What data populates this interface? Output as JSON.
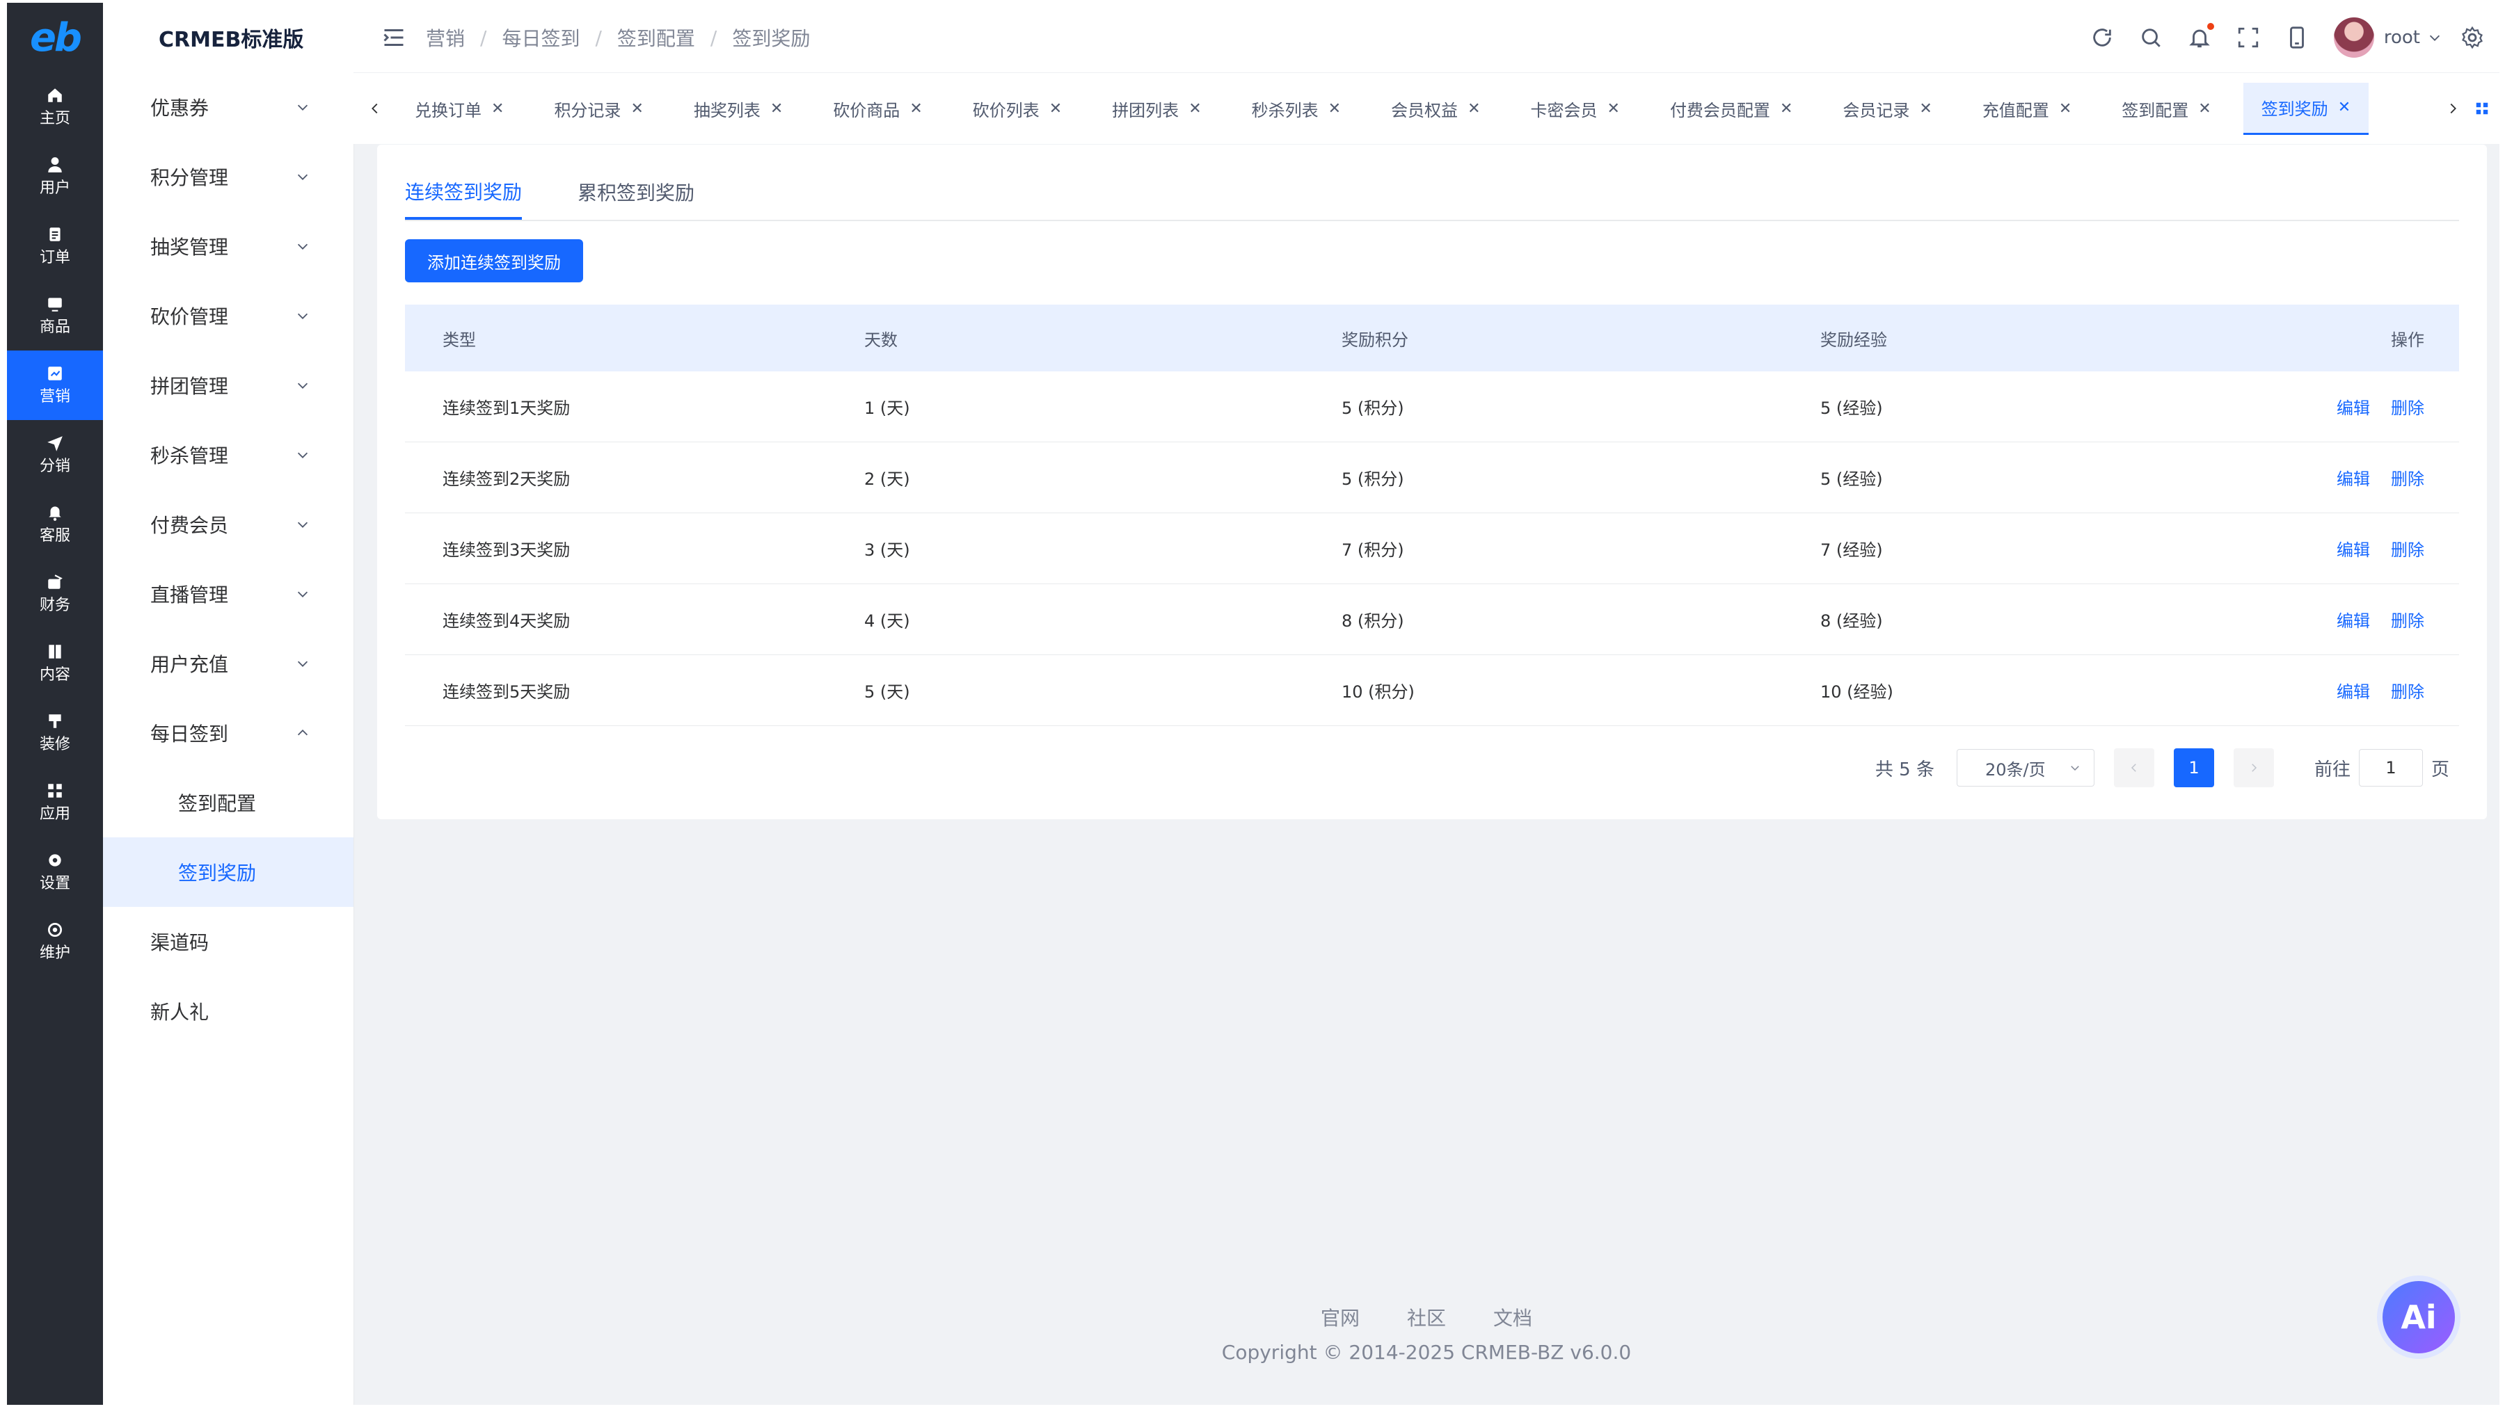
{
  "logo": "eb",
  "brand": "CRMEB标准版",
  "rail": [
    {
      "label": "主页",
      "icon": "home-icon"
    },
    {
      "label": "用户",
      "icon": "user-icon"
    },
    {
      "label": "订单",
      "icon": "order-icon"
    },
    {
      "label": "商品",
      "icon": "product-icon"
    },
    {
      "label": "营销",
      "icon": "marketing-icon",
      "active": true
    },
    {
      "label": "分销",
      "icon": "distribution-icon"
    },
    {
      "label": "客服",
      "icon": "service-icon"
    },
    {
      "label": "财务",
      "icon": "finance-icon"
    },
    {
      "label": "内容",
      "icon": "content-icon"
    },
    {
      "label": "装修",
      "icon": "decoration-icon"
    },
    {
      "label": "应用",
      "icon": "apps-icon"
    },
    {
      "label": "设置",
      "icon": "settings-icon"
    },
    {
      "label": "维护",
      "icon": "maintenance-icon"
    }
  ],
  "submenu": {
    "items": [
      "优惠券",
      "积分管理",
      "抽奖管理",
      "砍价管理",
      "拼团管理",
      "秒杀管理",
      "付费会员",
      "直播管理",
      "用户充值",
      "每日签到"
    ],
    "sub_items": [
      "签到配置",
      "签到奖励"
    ],
    "after_items": [
      "渠道码",
      "新人礼"
    ]
  },
  "breadcrumb": [
    "营销",
    "每日签到",
    "签到配置",
    "签到奖励"
  ],
  "user": {
    "name": "root"
  },
  "tabs": [
    "兑换订单",
    "积分记录",
    "抽奖列表",
    "砍价商品",
    "砍价列表",
    "拼团列表",
    "秒杀列表",
    "会员权益",
    "卡密会员",
    "付费会员配置",
    "会员记录",
    "充值配置",
    "签到配置",
    "签到奖励"
  ],
  "content_tabs": [
    "连续签到奖励",
    "累积签到奖励"
  ],
  "add_button": "添加连续签到奖励",
  "table": {
    "headers": [
      "类型",
      "天数",
      "奖励积分",
      "奖励经验",
      "操作"
    ],
    "rows": [
      {
        "type": "连续签到1天奖励",
        "days": "1 (天)",
        "points": "5 (积分)",
        "exp": "5 (经验)",
        "edit": "编辑",
        "delete": "删除"
      },
      {
        "type": "连续签到2天奖励",
        "days": "2 (天)",
        "points": "5 (积分)",
        "exp": "5 (经验)",
        "edit": "编辑",
        "delete": "删除"
      },
      {
        "type": "连续签到3天奖励",
        "days": "3 (天)",
        "points": "7 (积分)",
        "exp": "7 (经验)",
        "edit": "编辑",
        "delete": "删除"
      },
      {
        "type": "连续签到4天奖励",
        "days": "4 (天)",
        "points": "8 (积分)",
        "exp": "8 (经验)",
        "edit": "编辑",
        "delete": "删除"
      },
      {
        "type": "连续签到5天奖励",
        "days": "5 (天)",
        "points": "10 (积分)",
        "exp": "10 (经验)",
        "edit": "编辑",
        "delete": "删除"
      }
    ]
  },
  "pagination": {
    "total": "共 5 条",
    "page_size": "20条/页",
    "current": "1",
    "goto_label": "前往",
    "goto_value": "1",
    "page_suffix": "页"
  },
  "footer": {
    "links": [
      "官网",
      "社区",
      "文档"
    ],
    "copyright": "Copyright © 2014-2025 CRMEB-BZ v6.0.0"
  },
  "ai_label": "Ai",
  "colors": {
    "primary": "#1768ff",
    "rail_bg": "#282c34",
    "active_bg": "#e8f0ff"
  }
}
